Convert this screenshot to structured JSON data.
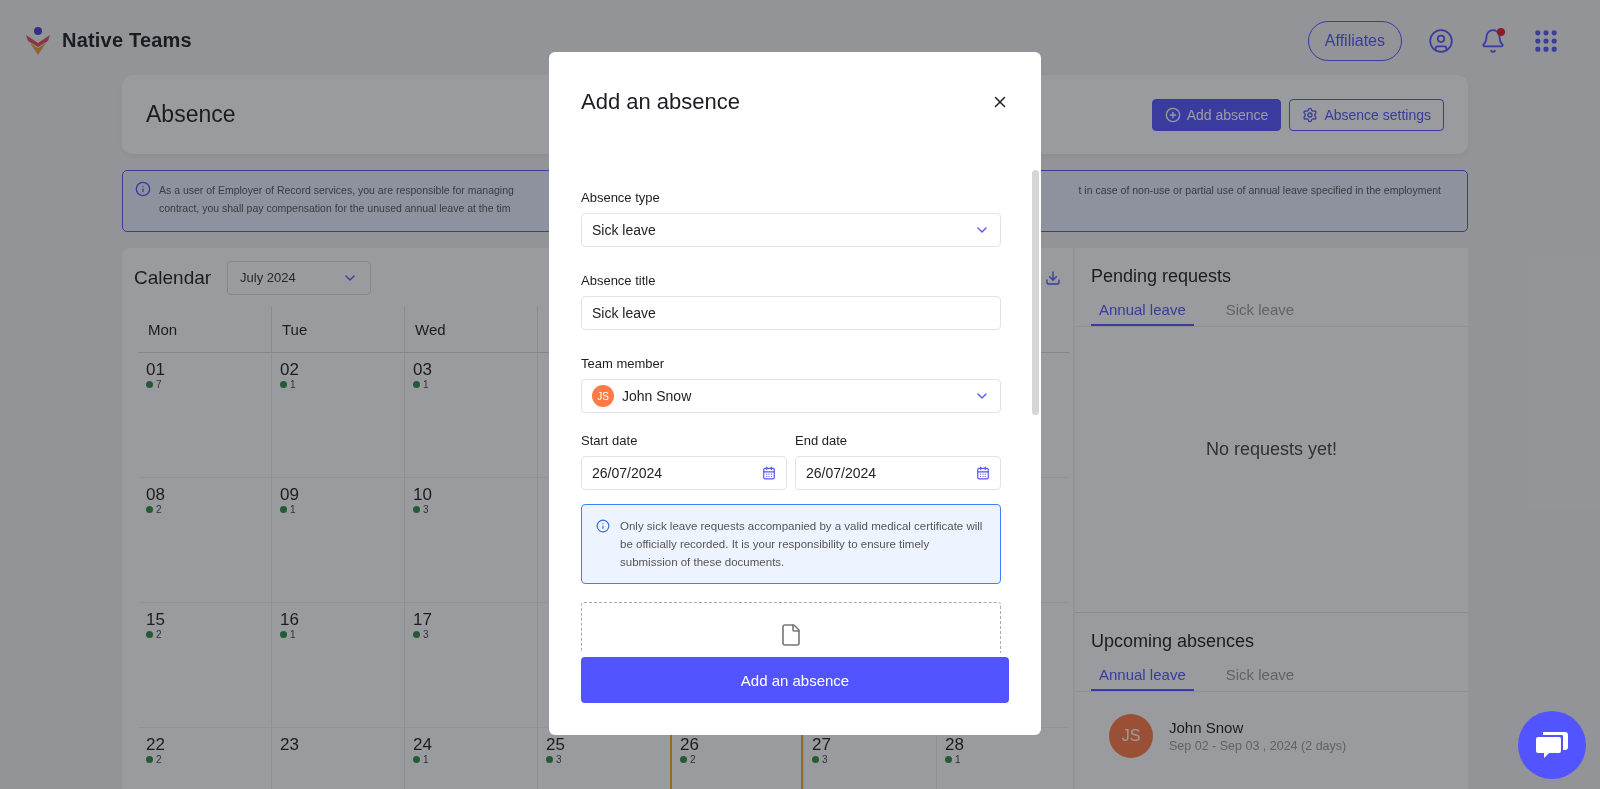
{
  "brand": {
    "name": "Native Teams"
  },
  "top_actions": {
    "affiliates": "Affiliates",
    "notifications": true
  },
  "page": {
    "title": "Absence",
    "buttons": [
      {
        "kind": "primary",
        "label": "Add absence"
      },
      {
        "kind": "settings",
        "label": "Absence settings"
      }
    ]
  },
  "notice": {
    "left_lines": [
      "As a user of Employer of Record services, you are responsible for managing",
      "contract, you shall pay compensation for the unused annual leave at the tim"
    ],
    "right_lines": [
      "t in case of non-use or partial use of annual leave specified in the employment"
    ]
  },
  "calendar": {
    "title": "Calendar",
    "month": "July 2024",
    "weekdays": [
      "Mon",
      "Tue",
      "Wed"
    ],
    "weeks": [
      [
        {
          "day": "01",
          "count": "7",
          "today": false
        },
        {
          "day": "02",
          "count": "1",
          "today": false
        },
        {
          "day": "03",
          "count": "1",
          "today": false
        }
      ],
      [
        {
          "day": "08",
          "count": "2",
          "today": false
        },
        {
          "day": "09",
          "count": "1",
          "today": false
        },
        {
          "day": "10",
          "count": "3",
          "today": false
        }
      ],
      [
        {
          "day": "15",
          "count": "2",
          "today": false
        },
        {
          "day": "16",
          "count": "1",
          "today": false
        },
        {
          "day": "17",
          "count": "3",
          "today": false
        }
      ],
      [
        {
          "day": "22",
          "count": "2",
          "today": false
        },
        {
          "day": "23",
          "today": false
        },
        {
          "day": "24",
          "count": "1",
          "today": false
        },
        {
          "day": "25",
          "count": "3",
          "today": false
        },
        {
          "day": "26",
          "count": "2",
          "today": true
        },
        {
          "day": "27",
          "count": "3",
          "today": false
        },
        {
          "day": "28",
          "count": "1",
          "today": false
        }
      ]
    ]
  },
  "pending": {
    "title": "Pending requests",
    "tabs": [
      {
        "label": "Annual leave",
        "selected": true
      },
      {
        "label": "Sick leave",
        "selected": false
      }
    ],
    "empty": "No requests yet!"
  },
  "upcoming": {
    "title": "Upcoming absences",
    "tabs": [
      {
        "label": "Annual leave",
        "selected": true
      },
      {
        "label": "Sick leave",
        "selected": false
      }
    ],
    "items": [
      {
        "initials": "JS",
        "name": "John Snow",
        "dates": "Sep 02 - Sep 03 , 2024 (2 days)"
      }
    ]
  },
  "modal": {
    "title": "Add an absence",
    "fields": [
      {
        "kind": "select",
        "label": "Absence type",
        "value": "Sick leave"
      },
      {
        "kind": "input",
        "label": "Absence title",
        "value": "Sick leave"
      },
      {
        "kind": "member",
        "label": "Team member",
        "initials": "JS",
        "value": "John Snow"
      },
      {
        "kind": "dates",
        "items": [
          {
            "label": "Start date",
            "value": "26/07/2024"
          },
          {
            "label": "End date",
            "value": "26/07/2024"
          }
        ]
      },
      {
        "kind": "notice",
        "text": "Only sick leave requests accompanied by a valid medical certificate will be officially recorded. It is your responsibility to ensure timely submission of these documents."
      },
      {
        "kind": "upload"
      }
    ],
    "submit": "Add an absence"
  }
}
